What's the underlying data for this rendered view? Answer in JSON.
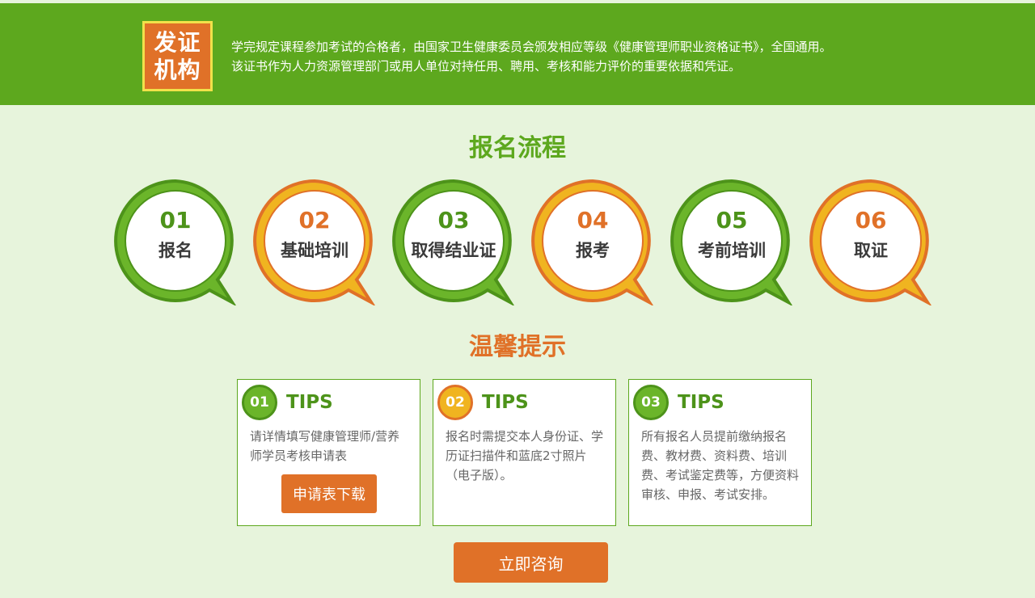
{
  "banner": {
    "badge_line1": "发证",
    "badge_line2": "机构",
    "text_line1": "学完规定课程参加考试的合格者，由国家卫生健康委员会颁发相应等级《健康管理师职业资格证书》，全国通用。",
    "text_line2": "该证书作为人力资源管理部门或用人单位对持任用、聘用、考核和能力评价的重要依据和凭证。"
  },
  "process": {
    "title": "报名流程",
    "steps": [
      {
        "num": "01",
        "label": "报名"
      },
      {
        "num": "02",
        "label": "基础培训"
      },
      {
        "num": "03",
        "label": "取得结业证"
      },
      {
        "num": "04",
        "label": "报考"
      },
      {
        "num": "05",
        "label": "考前培训"
      },
      {
        "num": "06",
        "label": "取证"
      }
    ]
  },
  "tips": {
    "title": "温馨提示",
    "cards": [
      {
        "num": "01",
        "title": "TIPS",
        "body": "请详情填写健康管理师/营养师学员考核申请表",
        "button": "申请表下载"
      },
      {
        "num": "02",
        "title": "TIPS",
        "body": "报名时需提交本人身份证、学历证扫描件和蓝底2寸照片（电子版）。"
      },
      {
        "num": "03",
        "title": "TIPS",
        "body": "所有报名人员提前缴纳报名费、教材费、资料费、培训费、考试鉴定费等，方便资料审核、申报、考试安排。"
      }
    ]
  },
  "consult_button": "立即咨询",
  "colors": {
    "brand_green": "#5da81e",
    "dark_green": "#4d931a",
    "accent_orange": "#e07128",
    "accent_yellow": "#f0b420",
    "page_bg": "#e7f4dc"
  }
}
